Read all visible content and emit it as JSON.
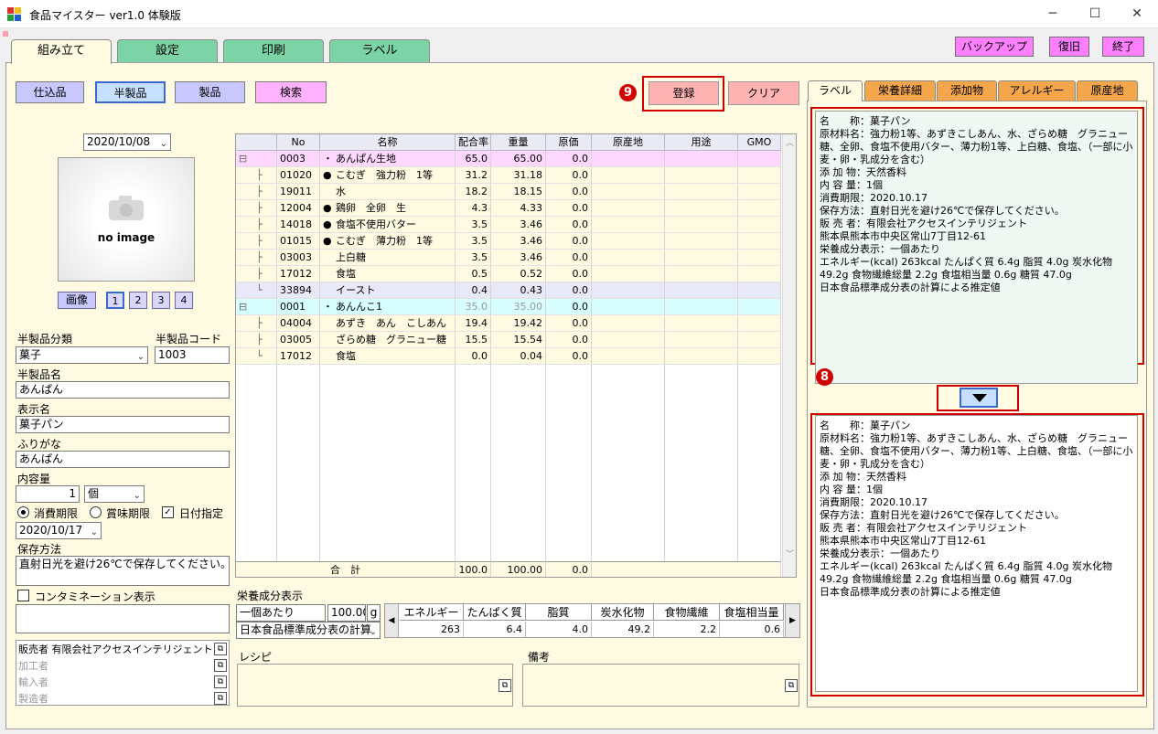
{
  "window": {
    "title": "食品マイスター ver1.0 体験版",
    "controls": {
      "minimize": "─",
      "maximize": "☐",
      "close": "✕"
    }
  },
  "main_tabs": [
    "組み立て",
    "設定",
    "印刷",
    "ラベル"
  ],
  "top_buttons": {
    "backup": "バックアップ",
    "restore": "復旧",
    "exit": "終了"
  },
  "mode_buttons": [
    "仕込品",
    "半製品",
    "製品",
    "検索"
  ],
  "actions": {
    "register": "登録",
    "clear": "クリア",
    "register_badge": "9",
    "convert_badge": "8"
  },
  "left": {
    "date": "2020/10/08",
    "no_image": "no image",
    "image_button": "画像",
    "image_pages": [
      "1",
      "2",
      "3",
      "4"
    ],
    "category_label": "半製品分類",
    "category_value": "菓子",
    "code_label": "半製品コード",
    "code_value": "1003",
    "name_label": "半製品名",
    "name_value": "あんぱん",
    "display_label": "表示名",
    "display_value": "菓子パン",
    "furigana_label": "ふりがな",
    "furigana_value": "あんぱん",
    "content_label": "内容量",
    "content_value": "1",
    "content_unit": "個",
    "expiry_use": "消費期限",
    "expiry_best": "賞味期限",
    "date_spec": "日付指定",
    "expiry_date": "2020/10/17",
    "storage_label": "保存方法",
    "storage_value": "直射日光を避け26℃で保存してください。",
    "contamination_label": "コンタミネーション表示",
    "parties": [
      "販売者 有限会社アクセスインテリジェント",
      "加工者",
      "輸入者",
      "製造者"
    ]
  },
  "grid": {
    "headers": [
      "No",
      "名称",
      "配合率",
      "重量",
      "原価",
      "原産地",
      "用途",
      "GMO"
    ],
    "rows": [
      {
        "tree": "⊟",
        "no": "0003",
        "mark": "・",
        "name": "あんぱん生地",
        "rate": "65.0",
        "weight": "65.00",
        "cost": "0.0",
        "type": "parent1"
      },
      {
        "tree": "├",
        "no": "01020",
        "mark": "●",
        "name": "こむぎ　強力粉　1等",
        "rate": "31.2",
        "weight": "31.18",
        "cost": "0.0",
        "type": "child"
      },
      {
        "tree": "├",
        "no": "19011",
        "mark": "",
        "name": "水",
        "rate": "18.2",
        "weight": "18.15",
        "cost": "0.0",
        "type": "child"
      },
      {
        "tree": "├",
        "no": "12004",
        "mark": "●",
        "name": "鶏卵　全卵　生",
        "rate": "4.3",
        "weight": "4.33",
        "cost": "0.0",
        "type": "child"
      },
      {
        "tree": "├",
        "no": "14018",
        "mark": "●",
        "name": "食塩不使用バター",
        "rate": "3.5",
        "weight": "3.46",
        "cost": "0.0",
        "type": "child"
      },
      {
        "tree": "├",
        "no": "01015",
        "mark": "●",
        "name": "こむぎ　薄力粉　1等",
        "rate": "3.5",
        "weight": "3.46",
        "cost": "0.0",
        "type": "child"
      },
      {
        "tree": "├",
        "no": "03003",
        "mark": "",
        "name": "上白糖",
        "rate": "3.5",
        "weight": "3.46",
        "cost": "0.0",
        "type": "child"
      },
      {
        "tree": "├",
        "no": "17012",
        "mark": "",
        "name": "食塩",
        "rate": "0.5",
        "weight": "0.52",
        "cost": "0.0",
        "type": "child"
      },
      {
        "tree": "└",
        "no": "33894",
        "mark": "",
        "name": "イースト",
        "rate": "0.4",
        "weight": "0.43",
        "cost": "0.0",
        "type": "child-sel"
      },
      {
        "tree": "⊟",
        "no": "0001",
        "mark": "・",
        "name": "あんんこ1",
        "rate": "35.0",
        "weight": "35.00",
        "cost": "0.0",
        "type": "parent2"
      },
      {
        "tree": "├",
        "no": "04004",
        "mark": "",
        "name": "あずき　あん　こしあん",
        "rate": "19.4",
        "weight": "19.42",
        "cost": "0.0",
        "type": "child"
      },
      {
        "tree": "├",
        "no": "03005",
        "mark": "",
        "name": "ざらめ糖　グラニュー糖",
        "rate": "15.5",
        "weight": "15.54",
        "cost": "0.0",
        "type": "child"
      },
      {
        "tree": "└",
        "no": "17012",
        "mark": "",
        "name": "食塩",
        "rate": "0.0",
        "weight": "0.04",
        "cost": "0.0",
        "type": "child"
      }
    ],
    "total": {
      "label": "合　計",
      "rate": "100.0",
      "weight": "100.00",
      "cost": "0.0"
    }
  },
  "nutrition": {
    "title": "栄養成分表示",
    "per": "一個あたり",
    "amount": "100.00",
    "unit": "g",
    "source": "日本食品標準成分表の計算",
    "headers": [
      "エネルギー",
      "たんぱく質",
      "脂質",
      "炭水化物",
      "食物繊維",
      "食塩相当量"
    ],
    "values": [
      "263",
      "6.4",
      "4.0",
      "49.2",
      "2.2",
      "0.6"
    ]
  },
  "recipe_label": "レシピ",
  "notes_label": "備考",
  "right_tabs": [
    "ラベル",
    "栄養詳細",
    "添加物",
    "アレルギー",
    "原産地"
  ],
  "label_text_top": "名　　称：菓子パン\n原材料名：強力粉1等、あずきこしあん、水、ざらめ糖　グラニュー糖、全卵、食塩不使用バター、薄力粉1等、上白糖、食塩、（一部に小麦・卵・乳成分を含む）\n添 加 物：天然香料\n内 容 量：1個\n消費期限：2020.10.17\n保存方法：直射日光を避け26℃で保存してください。\n販 売 者：有限会社アクセスインテリジェント\n熊本県熊本市中央区常山7丁目12-61\n栄養成分表示：一個あたり\nエネルギー(kcal) 263kcal たんぱく質 6.4g 脂質 4.0g 炭水化物 49.2g 食物繊維総量 2.2g 食塩相当量 0.6g 糖質 47.0g\n日本食品標準成分表の計算による推定値",
  "label_text_bottom": "名　　称：菓子パン\n原材料名：強力粉1等、あずきこしあん、水、ざらめ糖　グラニュー糖、全卵、食塩不使用バター、薄力粉1等、上白糖、食塩、（一部に小麦・卵・乳成分を含む）\n添 加 物：天然香料\n内 容 量：1個\n消費期限：2020.10.17\n保存方法：直射日光を避け26℃で保存してください。\n販 売 者：有限会社アクセスインテリジェント\n熊本県熊本市中央区常山7丁目12-61\n栄養成分表示：一個あたり\nエネルギー(kcal) 263kcal たんぱく質 6.4g 脂質 4.0g 炭水化物 49.2g 食物繊維総量 2.2g 食塩相当量 0.6g 糖質 47.0g\n日本食品標準成分表の計算による推定値"
}
